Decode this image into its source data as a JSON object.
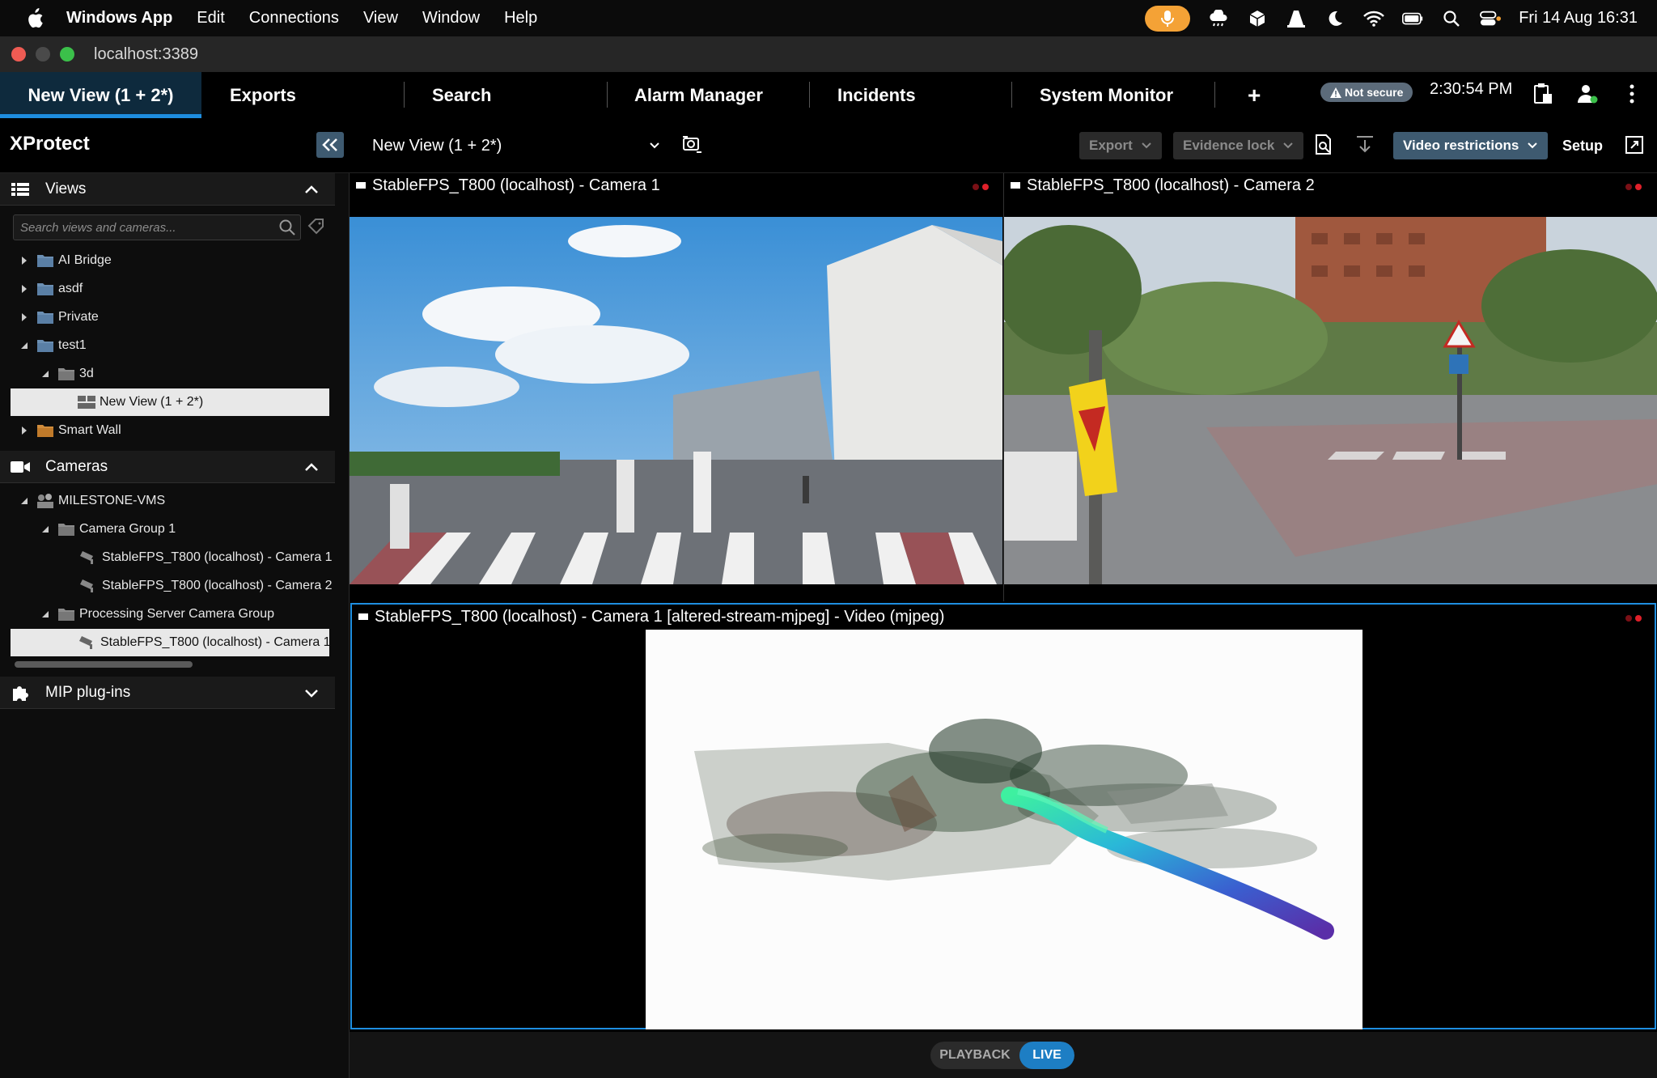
{
  "menubar": {
    "app_name": "Windows App",
    "items": [
      "Edit",
      "Connections",
      "View",
      "Window",
      "Help"
    ],
    "clock": "Fri 14 Aug  16:31"
  },
  "window": {
    "title": "localhost:3389"
  },
  "tabs": {
    "items": [
      "New View (1 + 2*)",
      "Exports",
      "Search",
      "Alarm Manager",
      "Incidents",
      "System Monitor"
    ],
    "add_label": "+",
    "not_secure": "Not secure",
    "time": "2:30:54 PM"
  },
  "toolbar": {
    "brand": "XProtect",
    "view_name": "New View (1 + 2*)",
    "export_label": "Export",
    "evidence_lock_label": "Evidence lock",
    "video_restrictions_label": "Video restrictions",
    "setup_label": "Setup"
  },
  "sidebar": {
    "views_header": "Views",
    "search_placeholder": "Search views and cameras...",
    "views_tree": [
      "AI Bridge",
      "asdf",
      "Private",
      "test1",
      "3d",
      "New View (1 + 2*)",
      "Smart Wall"
    ],
    "cameras_header": "Cameras",
    "cameras_tree": [
      "MILESTONE-VMS",
      "Camera Group 1",
      "StableFPS_T800 (localhost) - Camera 1",
      "StableFPS_T800 (localhost) - Camera 2",
      "Processing Server Camera Group",
      "StableFPS_T800 (localhost) - Camera 1"
    ],
    "mip_header": "MIP plug-ins"
  },
  "panes": {
    "cam1_title": "StableFPS_T800 (localhost) - Camera 1",
    "cam2_title": "StableFPS_T800 (localhost) - Camera 2",
    "cam3_title": "StableFPS_T800 (localhost) - Camera 1 [altered-stream-mjpeg] - Video (mjpeg)"
  },
  "mode": {
    "playback": "PLAYBACK",
    "live": "LIVE"
  },
  "colors": {
    "accent": "#1e8ee0",
    "active_tab_bg": "#0e2a3d",
    "mic": "#f4a236",
    "button": "#3e5a70"
  }
}
